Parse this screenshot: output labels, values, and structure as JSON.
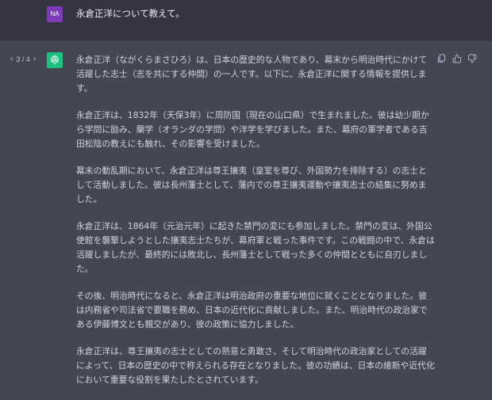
{
  "user": {
    "avatar_initials": "NA",
    "message": "永倉正洋について教えて。"
  },
  "assistant": {
    "pager": {
      "current": "3",
      "separator": "/",
      "total": "4",
      "display": "3 / 4"
    },
    "paragraphs": [
      "永倉正洋（ながくらまさひろ）は、日本の歴史的な人物であり、幕末から明治時代にかけて活躍した志士（志を共にする仲間）の一人です。以下に、永倉正洋に関する情報を提供します。",
      "永倉正洋は、1832年（天保3年）に周防国（現在の山口県）で生まれました。彼は幼少期から学問に励み、蘭学（オランダの学問）や洋学を学びました。また、幕府の軍学者である吉田松陰の教えにも触れ、その影響を受けました。",
      "幕末の動乱期において、永倉正洋は尊王攘夷（皇室を尊び、外国勢力を排除する）の志士として活動しました。彼は長州藩士として、藩内での尊王攘夷運動や攘夷志士の結集に努めました。",
      "永倉正洋は、1864年（元治元年）に起きた禁門の変にも参加しました。禁門の変は、外国公使館を襲撃しようとした攘夷志士たちが、幕府軍と戦った事件です。この戦闘の中で、永倉は活躍しましたが、最終的には敗北し、長州藩士として戦った多くの仲間とともに自刃しました。",
      "その後、明治時代になると、永倉正洋は明治政府の重要な地位に就くこととなりました。彼は内務省や司法省で要職を務め、日本の近代化に貢献しました。また、明治時代の政治家である伊藤博文とも親交があり、彼の政策に協力しました。",
      "永倉正洋は、尊王攘夷の志士としての熱意と勇敢さ、そして明治時代の政治家としての活躍によって、日本の歴史の中で称えられる存在となりました。彼の功績は、日本の維新や近代化において重要な役割を果たしたとされています。"
    ]
  },
  "colors": {
    "user_bg": "#343541",
    "assistant_bg": "#444654",
    "user_avatar": "#7e3ab8",
    "bot_avatar": "#19c37d"
  },
  "icons": [
    "chevron-left-icon",
    "chevron-right-icon",
    "openai-logo-icon",
    "copy-icon",
    "thumbs-up-icon",
    "thumbs-down-icon"
  ]
}
